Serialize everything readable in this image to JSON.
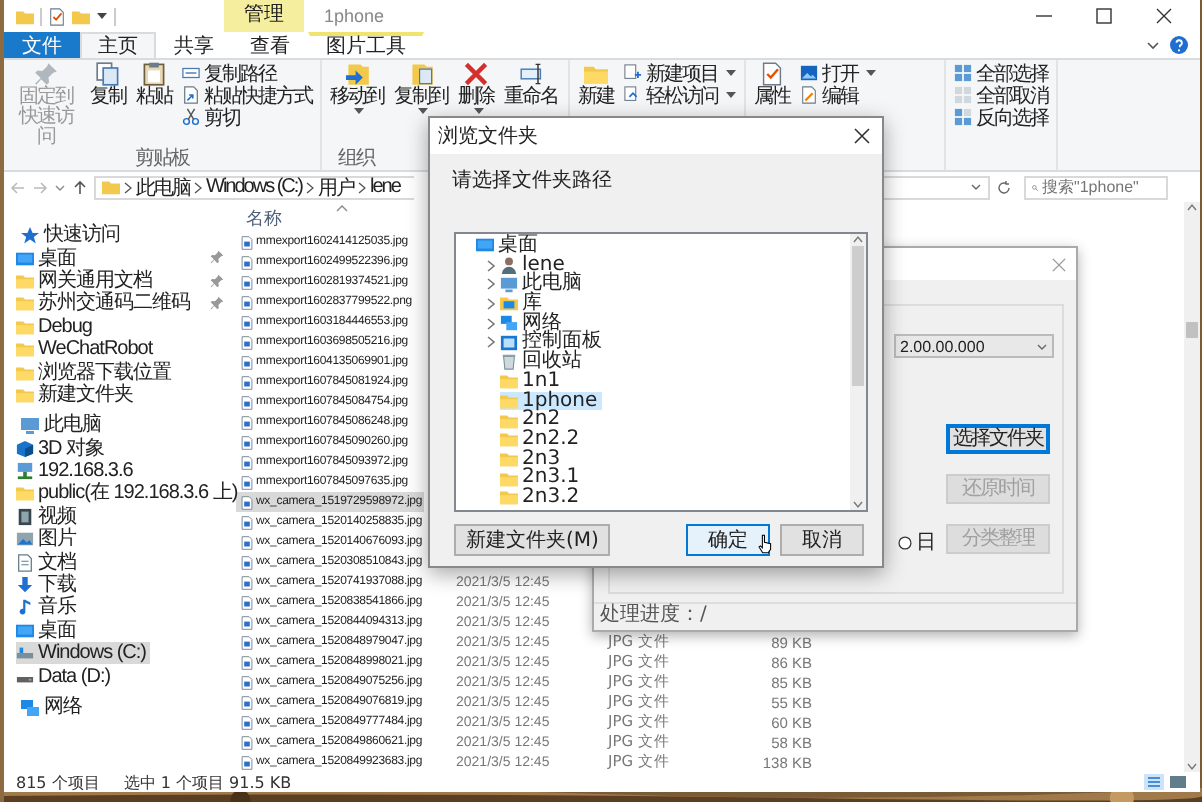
{
  "window": {
    "title": "1phone",
    "context_tab": "管理"
  },
  "tabs": [
    {
      "label": "文件",
      "kind": "file",
      "selected": false
    },
    {
      "label": "主页",
      "kind": "tab",
      "selected": true
    },
    {
      "label": "共享",
      "kind": "tab",
      "selected": false
    },
    {
      "label": "查看",
      "kind": "tab",
      "selected": false
    },
    {
      "label": "图片工具",
      "kind": "context",
      "selected": false
    }
  ],
  "ribbon": [
    {
      "label": "剪贴板",
      "items": [
        {
          "label": "固定到快速访问",
          "kind": "large",
          "dropdown": false,
          "disabled": true
        },
        {
          "label": "复制",
          "kind": "large",
          "dropdown": false,
          "disabled": false
        },
        {
          "label": "粘贴",
          "kind": "large",
          "dropdown": false,
          "disabled": false
        },
        {
          "label": "复制路径",
          "kind": "small",
          "dropdown": false,
          "disabled": false
        },
        {
          "label": "粘贴快捷方式",
          "kind": "small",
          "dropdown": false,
          "disabled": false
        },
        {
          "label": "剪切",
          "kind": "small",
          "dropdown": false,
          "disabled": false
        }
      ]
    },
    {
      "label": "组织",
      "items": [
        {
          "label": "移动到",
          "kind": "large",
          "dropdown": true,
          "disabled": false
        },
        {
          "label": "复制到",
          "kind": "large",
          "dropdown": true,
          "disabled": false
        },
        {
          "label": "删除",
          "kind": "large",
          "dropdown": true,
          "disabled": false
        },
        {
          "label": "重命名",
          "kind": "large",
          "dropdown": false,
          "disabled": false
        }
      ]
    },
    {
      "items": [
        {
          "label": "新建",
          "kind": "large",
          "dropdown": false,
          "disabled": false
        },
        {
          "label": "新建项目",
          "kind": "small",
          "dropdown": true,
          "disabled": false
        },
        {
          "label": "轻松访问",
          "kind": "small",
          "dropdown": true,
          "disabled": false
        }
      ]
    },
    {
      "items": [
        {
          "label": "属性",
          "kind": "large",
          "dropdown": false,
          "disabled": false
        },
        {
          "label": "打开",
          "kind": "small",
          "dropdown": true,
          "disabled": false
        },
        {
          "label": "编辑",
          "kind": "small",
          "dropdown": false,
          "disabled": false
        }
      ]
    },
    {
      "items": [
        {
          "label": "全部选择",
          "kind": "small",
          "dropdown": false,
          "disabled": false
        },
        {
          "label": "全部取消",
          "kind": "small",
          "dropdown": false,
          "disabled": false
        },
        {
          "label": "反向选择",
          "kind": "small",
          "dropdown": false,
          "disabled": false
        }
      ]
    }
  ],
  "address": {
    "path": [
      "此电脑",
      "Windows (C:)",
      "用户",
      "lene"
    ],
    "search_placeholder": "搜索\"1phone\""
  },
  "sidebar": [
    {
      "label": "快速访问",
      "selected": false,
      "children": [
        {
          "label": "桌面",
          "pinned": true,
          "selected": false
        },
        {
          "label": "网关通用文档",
          "pinned": true,
          "selected": false
        },
        {
          "label": "苏州交通码二维码",
          "pinned": true,
          "selected": false
        },
        {
          "label": "Debug",
          "pinned": false,
          "selected": false
        },
        {
          "label": "WeChatRobot",
          "pinned": false,
          "selected": false
        },
        {
          "label": "浏览器下载位置",
          "pinned": false,
          "selected": false
        },
        {
          "label": "新建文件夹",
          "pinned": false,
          "selected": false
        }
      ]
    },
    {
      "label": "此电脑",
      "selected": false,
      "children": [
        {
          "label": "3D 对象",
          "selected": false
        },
        {
          "label": "192.168.3.6",
          "selected": false
        },
        {
          "label": "public(在 192.168.3.6 上)",
          "selected": false
        },
        {
          "label": "视频",
          "selected": false
        },
        {
          "label": "图片",
          "selected": false
        },
        {
          "label": "文档",
          "selected": false
        },
        {
          "label": "下载",
          "selected": false
        },
        {
          "label": "音乐",
          "selected": false
        },
        {
          "label": "桌面",
          "selected": false
        },
        {
          "label": "Windows (C:)",
          "selected": true
        },
        {
          "label": "Data (D:)",
          "selected": false
        }
      ]
    },
    {
      "label": "网络",
      "selected": false
    }
  ],
  "table": {
    "columns": [
      {
        "label": "名称",
        "sorted": true
      }
    ],
    "rows": [
      {
        "name": "mmexport1602414125035.jpg",
        "selected": false
      },
      {
        "name": "mmexport1602499522396.jpg",
        "selected": false
      },
      {
        "name": "mmexport1602819374521.jpg",
        "selected": false
      },
      {
        "name": "mmexport1602837799522.png",
        "selected": false
      },
      {
        "name": "mmexport1603184446553.jpg",
        "selected": false
      },
      {
        "name": "mmexport1603698505216.jpg",
        "selected": false
      },
      {
        "name": "mmexport1604135069901.jpg",
        "selected": false
      },
      {
        "name": "mmexport1607845081924.jpg",
        "selected": false
      },
      {
        "name": "mmexport1607845084754.jpg",
        "selected": false
      },
      {
        "name": "mmexport1607845086248.jpg",
        "selected": false
      },
      {
        "name": "mmexport1607845090260.jpg",
        "selected": false
      },
      {
        "name": "mmexport1607845093972.jpg",
        "selected": false
      },
      {
        "name": "mmexport1607845097635.jpg",
        "selected": false
      },
      {
        "name": "wx_camera_1519729598972.jpg",
        "selected": true
      },
      {
        "name": "wx_camera_1520140258835.jpg",
        "selected": false
      },
      {
        "name": "wx_camera_1520140676093.jpg",
        "selected": false
      },
      {
        "name": "wx_camera_1520308510843.jpg",
        "selected": false
      },
      {
        "name": "wx_camera_1520741937088.jpg",
        "selected": false,
        "date": "2021/3/5 12:45"
      },
      {
        "name": "wx_camera_1520838541866.jpg",
        "selected": false,
        "date": "2021/3/5 12:45"
      },
      {
        "name": "wx_camera_1520844094313.jpg",
        "selected": false,
        "date": "2021/3/5 12:45"
      },
      {
        "name": "wx_camera_1520848979047.jpg",
        "selected": false,
        "date": "2021/3/5 12:45",
        "type": "JPG 文件",
        "size": "89 KB"
      },
      {
        "name": "wx_camera_1520848998021.jpg",
        "selected": false,
        "date": "2021/3/5 12:45",
        "type": "JPG 文件",
        "size": "86 KB"
      },
      {
        "name": "wx_camera_1520849075256.jpg",
        "selected": false,
        "date": "2021/3/5 12:45",
        "type": "JPG 文件",
        "size": "85 KB"
      },
      {
        "name": "wx_camera_1520849076819.jpg",
        "selected": false,
        "date": "2021/3/5 12:45",
        "type": "JPG 文件",
        "size": "55 KB"
      },
      {
        "name": "wx_camera_1520849777484.jpg",
        "selected": false,
        "date": "2021/3/5 12:45",
        "type": "JPG 文件",
        "size": "60 KB"
      },
      {
        "name": "wx_camera_1520849860621.jpg",
        "selected": false,
        "date": "2021/3/5 12:45",
        "type": "JPG 文件",
        "size": "58 KB"
      },
      {
        "name": "wx_camera_1520849923683.jpg",
        "selected": false,
        "date": "2021/3/5 12:45",
        "type": "JPG 文件",
        "size": "138 KB"
      }
    ]
  },
  "status_bar": {
    "count": "815 个项目",
    "selection": "选中 1 个项目  91.5 KB"
  },
  "tool_window": {
    "version": "2.00.00.000",
    "buttons": [
      {
        "label": "选择文件夹",
        "disabled": false,
        "focused": true
      },
      {
        "label": "还原时间",
        "disabled": true,
        "focused": false
      },
      {
        "label": "分类整理",
        "disabled": true,
        "focused": false
      }
    ],
    "radio": {
      "label": "日",
      "checked": false
    },
    "progress": "处理进度：/"
  },
  "dialog": {
    "title": "浏览文件夹",
    "prompt": "请选择文件夹路径",
    "tree": [
      {
        "label": "桌面",
        "selected": false,
        "children": [
          {
            "label": "lene",
            "expandable": true,
            "selected": false
          },
          {
            "label": "此电脑",
            "expandable": true,
            "selected": false
          },
          {
            "label": "库",
            "expandable": true,
            "selected": false
          },
          {
            "label": "网络",
            "expandable": true,
            "selected": false
          },
          {
            "label": "控制面板",
            "expandable": true,
            "selected": false
          },
          {
            "label": "回收站",
            "expandable": false,
            "selected": false
          },
          {
            "label": "1n1",
            "expandable": false,
            "selected": false
          },
          {
            "label": "1phone",
            "expandable": false,
            "selected": true
          },
          {
            "label": "2n2",
            "expandable": false,
            "selected": false
          },
          {
            "label": "2n2.2",
            "expandable": false,
            "selected": false
          },
          {
            "label": "2n3",
            "expandable": false,
            "selected": false
          },
          {
            "label": "2n3.1",
            "expandable": false,
            "selected": false
          },
          {
            "label": "2n3.2",
            "expandable": false,
            "selected": false
          }
        ]
      }
    ],
    "buttons": [
      {
        "label": "新建文件夹(M)",
        "default": false
      },
      {
        "label": "确定",
        "default": true
      },
      {
        "label": "取消",
        "default": false
      }
    ]
  }
}
